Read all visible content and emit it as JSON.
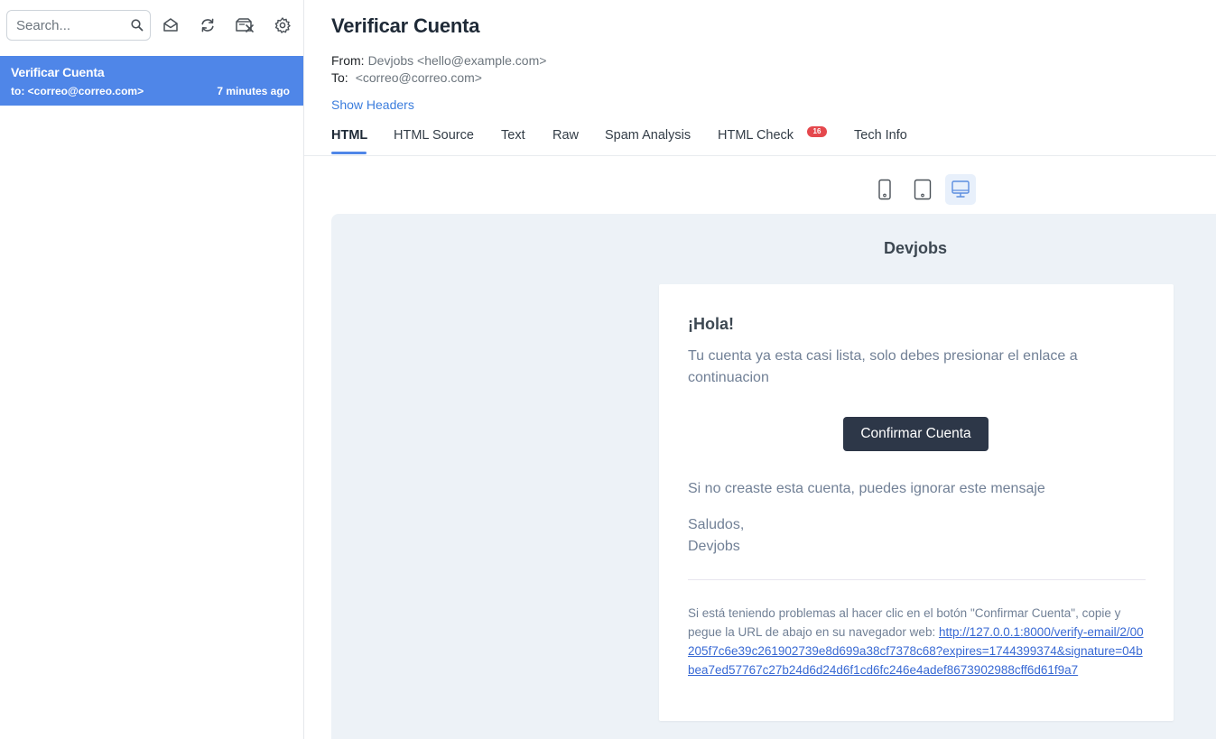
{
  "sidebar": {
    "search": {
      "placeholder": "Search..."
    },
    "messages": [
      {
        "subject": "Verificar Cuenta",
        "to": "to: <correo@correo.com>",
        "time": "7 minutes ago"
      }
    ]
  },
  "message": {
    "subject": "Verificar Cuenta",
    "from_label": "From:",
    "from_value": "Devjobs <hello@example.com>",
    "to_label": "To:",
    "to_value": "<correo@correo.com>",
    "show_headers": "Show Headers"
  },
  "tabs": [
    {
      "label": "HTML"
    },
    {
      "label": "HTML Source"
    },
    {
      "label": "Text"
    },
    {
      "label": "Raw"
    },
    {
      "label": "Spam Analysis"
    },
    {
      "label": "HTML Check",
      "badge": "16"
    },
    {
      "label": "Tech Info"
    }
  ],
  "email": {
    "brand": "Devjobs",
    "greeting": "¡Hola!",
    "intro": "Tu cuenta ya esta casi lista, solo debes presionar el enlace a continuacion",
    "button": "Confirmar Cuenta",
    "outro": "Si no creaste esta cuenta, puedes ignorar este mensaje",
    "salutation": "Saludos,",
    "signature": "Devjobs",
    "subcopy": "Si está teniendo problemas al hacer clic en el botón \"Confirmar Cuenta\", copie y pegue la URL de abajo en su navegador web:",
    "url": "http://127.0.0.1:8000/verify-email/2/00205f7c6e39c261902739e8d699a38cf7378c68?expires=1744399374&signature=04bbea7ed57767c27b24d6d24d6f1cd6fc246e4adef8673902988cff6d61f9a7"
  },
  "colors": {
    "accent": "#4f86e8",
    "link": "#3b7ddd",
    "badge": "#e5484d",
    "button": "#2d3748",
    "preview_bg": "#edf2f7"
  },
  "icons": [
    "search-icon",
    "mark-read-icon",
    "refresh-icon",
    "delete-all-icon",
    "settings-icon",
    "phone-view-icon",
    "tablet-view-icon",
    "desktop-view-icon"
  ]
}
